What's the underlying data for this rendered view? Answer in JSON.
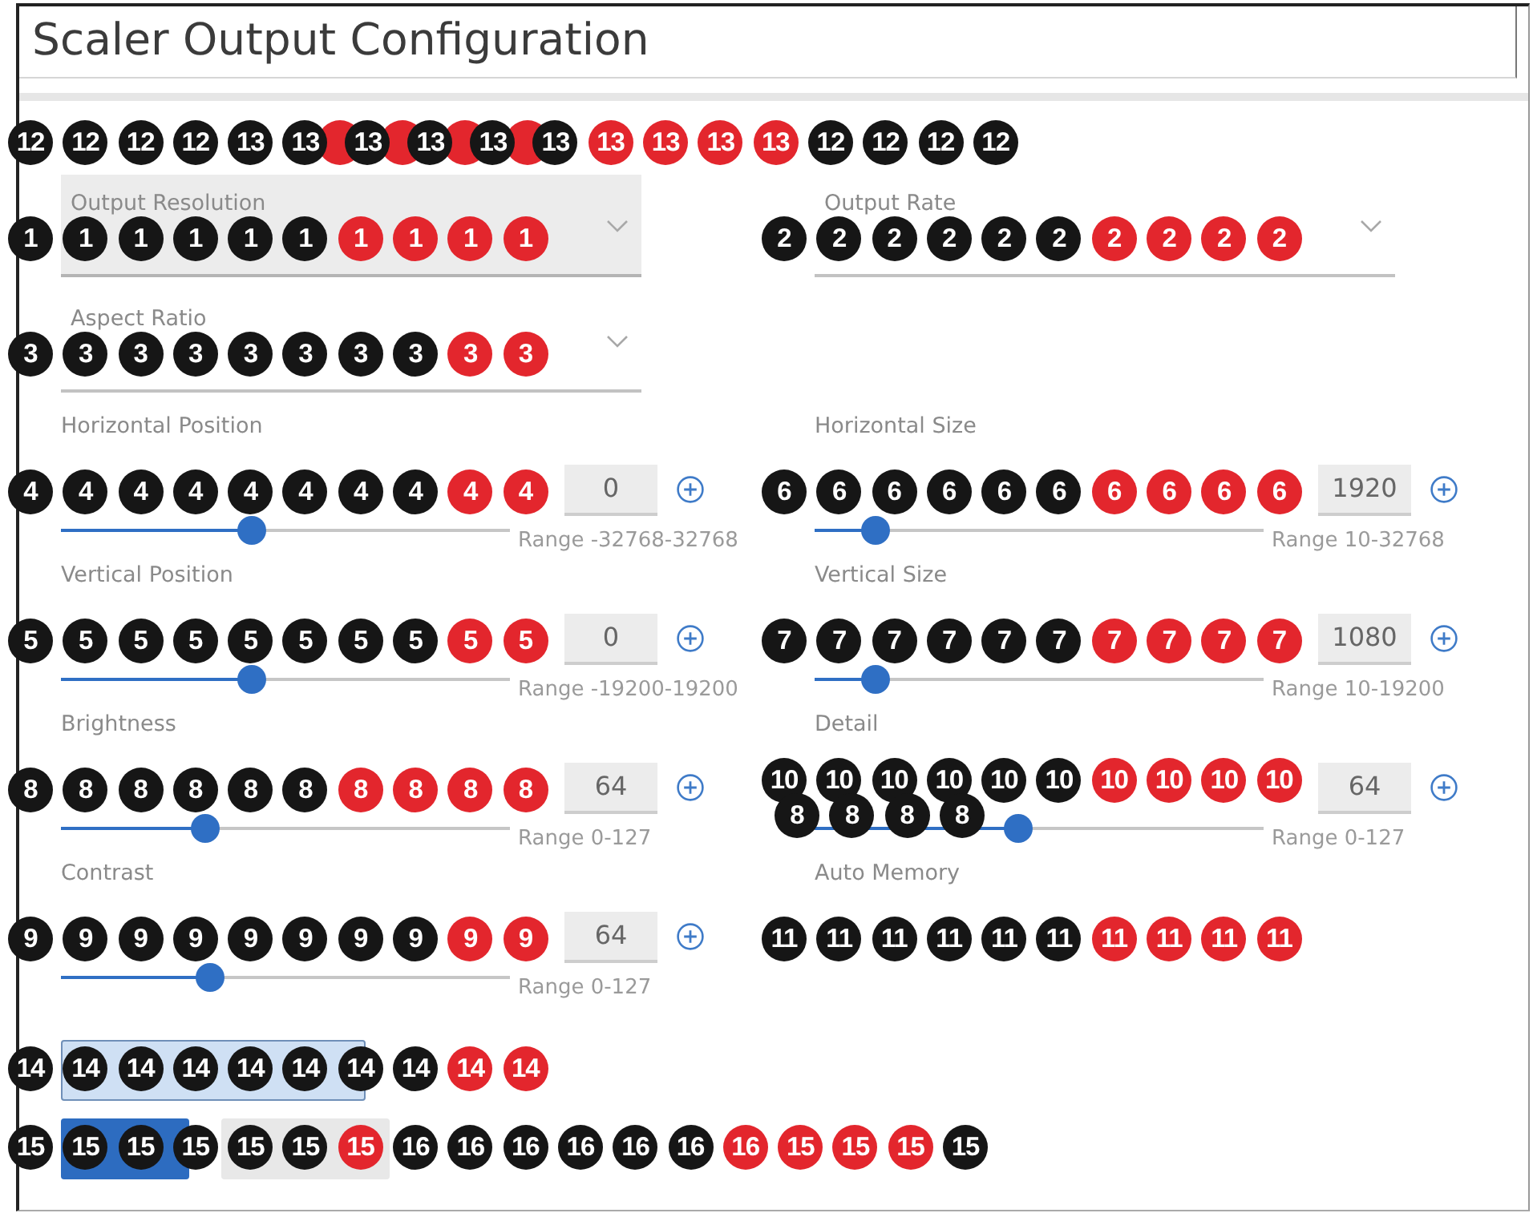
{
  "title": "Scaler Output Configuration",
  "top_markers": [
    {
      "label": "12",
      "color": "#161616",
      "kind": "spaced"
    },
    {
      "label": "12",
      "color": "#161616",
      "kind": "spaced"
    },
    {
      "label": "12",
      "color": "#161616",
      "kind": "spaced"
    },
    {
      "label": "12",
      "color": "#161616",
      "kind": "spaced"
    },
    {
      "label": "13",
      "color": "#161616",
      "kind": "spaced"
    },
    {
      "label": "13",
      "color": "#161616",
      "kind": "spaced"
    },
    {
      "color": "#e3262d",
      "kind": "behind"
    },
    {
      "label": "13",
      "color": "#161616",
      "kind": "front"
    },
    {
      "color": "#e3262d",
      "kind": "behind"
    },
    {
      "label": "13",
      "color": "#161616",
      "kind": "front"
    },
    {
      "color": "#e3262d",
      "kind": "behind"
    },
    {
      "label": "13",
      "color": "#161616",
      "kind": "front"
    },
    {
      "color": "#e3262d",
      "kind": "behind"
    },
    {
      "label": "13",
      "color": "#161616",
      "kind": "front"
    },
    {
      "label": "13",
      "color": "#e3262d",
      "kind": "spaced"
    },
    {
      "label": "13",
      "color": "#e3262d",
      "kind": "spaced"
    },
    {
      "label": "13",
      "color": "#e3262d",
      "kind": "spaced"
    },
    {
      "label": "13",
      "color": "#e3262d",
      "kind": "spaced"
    },
    {
      "label": "12",
      "color": "#161616",
      "kind": "spaced"
    },
    {
      "label": "12",
      "color": "#161616",
      "kind": "spaced"
    },
    {
      "label": "12",
      "color": "#161616",
      "kind": "spaced"
    },
    {
      "label": "12",
      "color": "#161616",
      "kind": "spaced"
    }
  ],
  "dropdowns": [
    {
      "label": "Output Resolution",
      "focused": true,
      "markers": [
        {
          "label": "1",
          "color": "#161616"
        },
        {
          "label": "1",
          "color": "#161616"
        },
        {
          "label": "1",
          "color": "#161616"
        },
        {
          "label": "1",
          "color": "#161616"
        },
        {
          "label": "1",
          "color": "#161616"
        },
        {
          "label": "1",
          "color": "#161616"
        },
        {
          "label": "1",
          "color": "#e3262d"
        },
        {
          "label": "1",
          "color": "#e3262d"
        },
        {
          "label": "1",
          "color": "#e3262d"
        },
        {
          "label": "1",
          "color": "#e3262d"
        }
      ]
    },
    {
      "label": "Output Rate",
      "focused": false,
      "markers": [
        {
          "label": "2",
          "color": "#161616"
        },
        {
          "label": "2",
          "color": "#161616"
        },
        {
          "label": "2",
          "color": "#161616"
        },
        {
          "label": "2",
          "color": "#161616"
        },
        {
          "label": "2",
          "color": "#161616"
        },
        {
          "label": "2",
          "color": "#161616"
        },
        {
          "label": "2",
          "color": "#e3262d"
        },
        {
          "label": "2",
          "color": "#e3262d"
        },
        {
          "label": "2",
          "color": "#e3262d"
        },
        {
          "label": "2",
          "color": "#e3262d"
        }
      ]
    },
    {
      "label": "Aspect Ratio",
      "focused": false,
      "markers": [
        {
          "label": "3",
          "color": "#161616"
        },
        {
          "label": "3",
          "color": "#161616"
        },
        {
          "label": "3",
          "color": "#161616"
        },
        {
          "label": "3",
          "color": "#161616"
        },
        {
          "label": "3",
          "color": "#161616"
        },
        {
          "label": "3",
          "color": "#161616"
        },
        {
          "label": "3",
          "color": "#161616"
        },
        {
          "label": "3",
          "color": "#161616"
        },
        {
          "label": "3",
          "color": "#e3262d"
        },
        {
          "label": "3",
          "color": "#e3262d"
        }
      ]
    }
  ],
  "settings": [
    {
      "kind": "slider",
      "label": "Horizontal Position",
      "level": 0.42,
      "value": "0",
      "range": "Range -32768-32768",
      "markers": [
        {
          "label": "4",
          "color": "#161616"
        },
        {
          "label": "4",
          "color": "#161616"
        },
        {
          "label": "4",
          "color": "#161616"
        },
        {
          "label": "4",
          "color": "#161616"
        },
        {
          "label": "4",
          "color": "#161616"
        },
        {
          "label": "4",
          "color": "#161616"
        },
        {
          "label": "4",
          "color": "#161616"
        },
        {
          "label": "4",
          "color": "#161616"
        },
        {
          "label": "4",
          "color": "#e3262d"
        },
        {
          "label": "4",
          "color": "#e3262d"
        }
      ]
    },
    {
      "kind": "slider",
      "label": "Horizontal Size",
      "level": 0.11,
      "value": "1920",
      "range": "Range 10-32768",
      "markers": [
        {
          "label": "6",
          "color": "#161616"
        },
        {
          "label": "6",
          "color": "#161616"
        },
        {
          "label": "6",
          "color": "#161616"
        },
        {
          "label": "6",
          "color": "#161616"
        },
        {
          "label": "6",
          "color": "#161616"
        },
        {
          "label": "6",
          "color": "#161616"
        },
        {
          "label": "6",
          "color": "#e3262d"
        },
        {
          "label": "6",
          "color": "#e3262d"
        },
        {
          "label": "6",
          "color": "#e3262d"
        },
        {
          "label": "6",
          "color": "#e3262d"
        }
      ]
    },
    {
      "kind": "slider",
      "label": "Vertical Position",
      "level": 0.42,
      "value": "0",
      "range": "Range -19200-19200",
      "markers": [
        {
          "label": "5",
          "color": "#161616"
        },
        {
          "label": "5",
          "color": "#161616"
        },
        {
          "label": "5",
          "color": "#161616"
        },
        {
          "label": "5",
          "color": "#161616"
        },
        {
          "label": "5",
          "color": "#161616"
        },
        {
          "label": "5",
          "color": "#161616"
        },
        {
          "label": "5",
          "color": "#161616"
        },
        {
          "label": "5",
          "color": "#161616"
        },
        {
          "label": "5",
          "color": "#e3262d"
        },
        {
          "label": "5",
          "color": "#e3262d"
        }
      ]
    },
    {
      "kind": "slider",
      "label": "Vertical Size",
      "level": 0.11,
      "value": "1080",
      "range": "Range 10-19200",
      "markers": [
        {
          "label": "7",
          "color": "#161616"
        },
        {
          "label": "7",
          "color": "#161616"
        },
        {
          "label": "7",
          "color": "#161616"
        },
        {
          "label": "7",
          "color": "#161616"
        },
        {
          "label": "7",
          "color": "#161616"
        },
        {
          "label": "7",
          "color": "#161616"
        },
        {
          "label": "7",
          "color": "#e3262d"
        },
        {
          "label": "7",
          "color": "#e3262d"
        },
        {
          "label": "7",
          "color": "#e3262d"
        },
        {
          "label": "7",
          "color": "#e3262d"
        }
      ]
    },
    {
      "kind": "slider",
      "label": "Brightness",
      "level": 0.31,
      "value": "64",
      "range": "Range 0-127",
      "markers": [
        {
          "label": "8",
          "color": "#161616"
        },
        {
          "label": "8",
          "color": "#161616"
        },
        {
          "label": "8",
          "color": "#161616"
        },
        {
          "label": "8",
          "color": "#161616"
        },
        {
          "label": "8",
          "color": "#161616"
        },
        {
          "label": "8",
          "color": "#161616"
        },
        {
          "label": "8",
          "color": "#e3262d"
        },
        {
          "label": "8",
          "color": "#e3262d"
        },
        {
          "label": "8",
          "color": "#e3262d"
        },
        {
          "label": "8",
          "color": "#e3262d"
        }
      ]
    },
    {
      "kind": "slider",
      "label": "Detail",
      "level": 0.45,
      "value": "64",
      "range": "Range 0-127",
      "markers": [
        {
          "label": "10",
          "color": "#161616"
        },
        {
          "label": "10",
          "color": "#161616"
        },
        {
          "label": "10",
          "color": "#161616"
        },
        {
          "label": "10",
          "color": "#161616"
        },
        {
          "label": "10",
          "color": "#161616"
        },
        {
          "label": "10",
          "color": "#161616"
        },
        {
          "label": "10",
          "color": "#e3262d"
        },
        {
          "label": "10",
          "color": "#e3262d"
        },
        {
          "label": "10",
          "color": "#e3262d"
        },
        {
          "label": "10",
          "color": "#e3262d"
        }
      ],
      "markers_below": [
        {
          "label": "8",
          "color": "#161616"
        },
        {
          "label": "8",
          "color": "#161616"
        },
        {
          "label": "8",
          "color": "#161616"
        },
        {
          "label": "8",
          "color": "#161616"
        }
      ]
    },
    {
      "kind": "slider",
      "label": "Contrast",
      "level": 0.32,
      "value": "64",
      "range": "Range 0-127",
      "markers": [
        {
          "label": "9",
          "color": "#161616"
        },
        {
          "label": "9",
          "color": "#161616"
        },
        {
          "label": "9",
          "color": "#161616"
        },
        {
          "label": "9",
          "color": "#161616"
        },
        {
          "label": "9",
          "color": "#161616"
        },
        {
          "label": "9",
          "color": "#161616"
        },
        {
          "label": "9",
          "color": "#161616"
        },
        {
          "label": "9",
          "color": "#161616"
        },
        {
          "label": "9",
          "color": "#e3262d"
        },
        {
          "label": "9",
          "color": "#e3262d"
        }
      ]
    },
    {
      "kind": "plain",
      "label": "Auto Memory",
      "markers": [
        {
          "label": "11",
          "color": "#161616"
        },
        {
          "label": "11",
          "color": "#161616"
        },
        {
          "label": "11",
          "color": "#161616"
        },
        {
          "label": "11",
          "color": "#161616"
        },
        {
          "label": "11",
          "color": "#161616"
        },
        {
          "label": "11",
          "color": "#161616"
        },
        {
          "label": "11",
          "color": "#e3262d"
        },
        {
          "label": "11",
          "color": "#e3262d"
        },
        {
          "label": "11",
          "color": "#e3262d"
        },
        {
          "label": "11",
          "color": "#e3262d"
        }
      ]
    }
  ],
  "button_rows": [
    {
      "buttons": [
        {
          "kind": "outlined"
        }
      ],
      "markers": [
        {
          "label": "14",
          "color": "#161616"
        },
        {
          "label": "14",
          "color": "#161616"
        },
        {
          "label": "14",
          "color": "#161616"
        },
        {
          "label": "14",
          "color": "#161616"
        },
        {
          "label": "14",
          "color": "#161616"
        },
        {
          "label": "14",
          "color": "#161616"
        },
        {
          "label": "14",
          "color": "#161616"
        },
        {
          "label": "14",
          "color": "#161616"
        },
        {
          "label": "14",
          "color": "#e3262d"
        },
        {
          "label": "14",
          "color": "#e3262d"
        }
      ]
    },
    {
      "buttons": [
        {
          "kind": "primary"
        },
        {
          "kind": "secondary"
        }
      ],
      "markers": [
        {
          "label": "15",
          "color": "#161616"
        },
        {
          "label": "15",
          "color": "#161616"
        },
        {
          "label": "15",
          "color": "#161616"
        },
        {
          "label": "15",
          "color": "#161616"
        },
        {
          "label": "15",
          "color": "#161616"
        },
        {
          "label": "15",
          "color": "#161616"
        },
        {
          "label": "15",
          "color": "#e3262d"
        },
        {
          "label": "16",
          "color": "#161616"
        },
        {
          "label": "16",
          "color": "#161616"
        },
        {
          "label": "16",
          "color": "#161616"
        },
        {
          "label": "16",
          "color": "#161616"
        },
        {
          "label": "16",
          "color": "#161616"
        },
        {
          "label": "16",
          "color": "#161616"
        },
        {
          "label": "16",
          "color": "#e3262d"
        },
        {
          "label": "15",
          "color": "#e3262d"
        },
        {
          "label": "15",
          "color": "#e3262d"
        },
        {
          "label": "15",
          "color": "#e3262d"
        },
        {
          "label": "15",
          "color": "#161616"
        }
      ]
    }
  ]
}
